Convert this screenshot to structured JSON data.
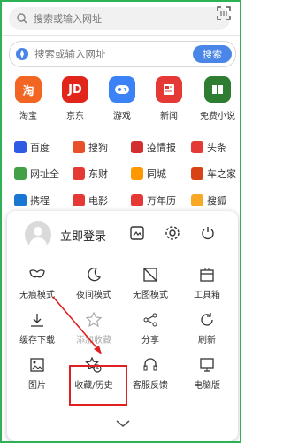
{
  "top": {
    "placeholder": "搜索或输入网址",
    "scan_icon": "scan-icon"
  },
  "search": {
    "placeholder": "搜索或输入网址",
    "button": "搜索",
    "icon": "compass-icon"
  },
  "apps": [
    {
      "label": "淘宝",
      "glyph": "淘",
      "color": "#f26522"
    },
    {
      "label": "京东",
      "glyph": "JD",
      "color": "#e1251b"
    },
    {
      "label": "游戏",
      "glyph": "🎮",
      "color": "#3b82f6"
    },
    {
      "label": "新闻",
      "glyph": "📰",
      "color": "#e53935"
    },
    {
      "label": "免费小说",
      "glyph": "📖",
      "color": "#2e7d32"
    }
  ],
  "links": [
    [
      {
        "label": "百度",
        "color": "#2d5be3"
      },
      {
        "label": "搜狗",
        "color": "#e8502a"
      },
      {
        "label": "疫情报",
        "color": "#d32f2f"
      },
      {
        "label": "头条",
        "color": "#e53935"
      }
    ],
    [
      {
        "label": "网址全",
        "color": "#43a047"
      },
      {
        "label": "东财",
        "color": "#e53935"
      },
      {
        "label": "同城",
        "color": "#ff9800"
      },
      {
        "label": "车之家",
        "color": "#d84315"
      }
    ],
    [
      {
        "label": "携程",
        "color": "#1976d2"
      },
      {
        "label": "电影",
        "color": "#e53935"
      },
      {
        "label": "万年历",
        "color": "#e53935"
      },
      {
        "label": "搜狐",
        "color": "#f9a825"
      }
    ]
  ],
  "sheet": {
    "login": "立即登录",
    "rows": [
      [
        "无痕模式",
        "夜间模式",
        "无图模式",
        "工具箱"
      ],
      [
        "缓存下载",
        "添加收藏",
        "分享",
        "刷新"
      ],
      [
        "图片",
        "收藏/历史",
        "客服反馈",
        "电脑版"
      ]
    ]
  },
  "colors": {
    "accent": "#4a86e8",
    "highlight": "#e02020",
    "frame": "#2fb257"
  }
}
